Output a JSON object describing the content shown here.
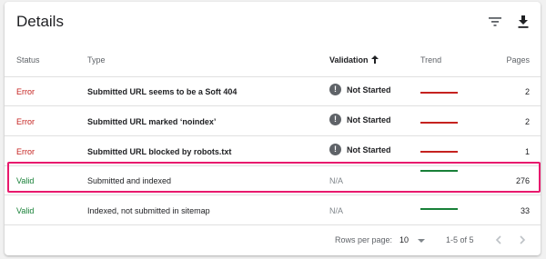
{
  "header": {
    "title": "Details",
    "filter_icon": "filter-icon",
    "download_icon": "download-icon"
  },
  "columns": {
    "status": "Status",
    "type": "Type",
    "validation": "Validation",
    "trend": "Trend",
    "pages": "Pages"
  },
  "rows": [
    {
      "status": "Error",
      "type": "Submitted URL seems to be a Soft 404",
      "validation": "Not Started",
      "pages": "2"
    },
    {
      "status": "Error",
      "type": "Submitted URL marked ‘noindex’",
      "validation": "Not Started",
      "pages": "2"
    },
    {
      "status": "Error",
      "type": "Submitted URL blocked by robots.txt",
      "validation": "Not Started",
      "pages": "1"
    },
    {
      "status": "Valid",
      "type": "Submitted and indexed",
      "validation": "N/A",
      "pages": "276"
    },
    {
      "status": "Valid",
      "type": "Indexed, not submitted in sitemap",
      "validation": "N/A",
      "pages": "33"
    }
  ],
  "colors": {
    "error": "#c5221f",
    "valid": "#188038",
    "highlight": "#e8196d"
  },
  "footer": {
    "rows_per_page_label": "Rows per page:",
    "rows_per_page_value": "10",
    "range": "1-5 of 5"
  }
}
